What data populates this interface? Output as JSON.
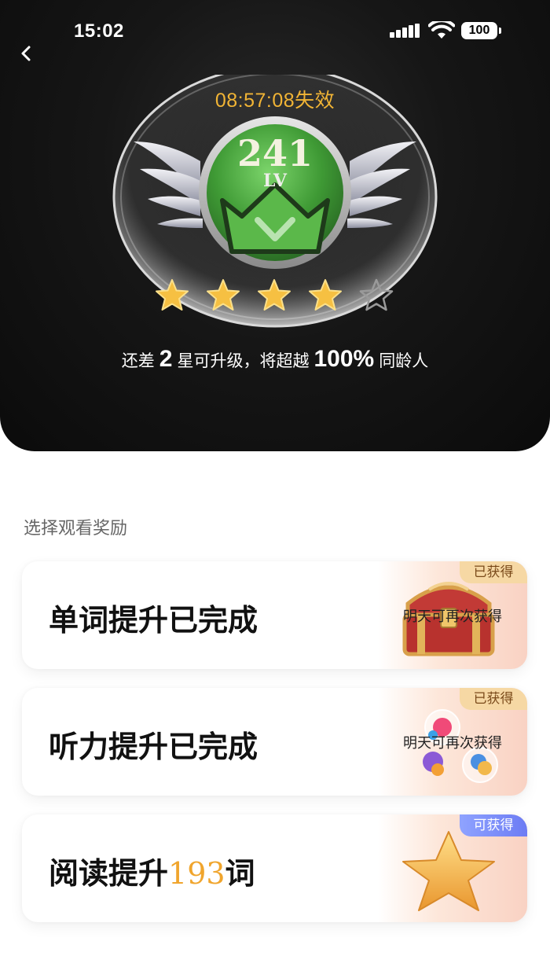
{
  "status_bar": {
    "time": "15:02",
    "battery": "100"
  },
  "hero": {
    "timer": "08:57:08失效",
    "level_number": "241",
    "level_unit": "LV",
    "stars_total": 5,
    "stars_filled": 4,
    "upgrade_prefix": "还差",
    "upgrade_stars_needed": "2",
    "upgrade_middle": "星可升级，将超越",
    "upgrade_percent": "100%",
    "upgrade_suffix": "同龄人"
  },
  "rewards": {
    "section_title": "选择观看奖励",
    "cards": [
      {
        "title": "单词提升已完成",
        "subtitle": "明天可再次获得",
        "tag": "已获得",
        "icon": "treasure-chest-icon"
      },
      {
        "title": "听力提升已完成",
        "subtitle": "明天可再次获得",
        "tag": "已获得",
        "icon": "candy-icon"
      },
      {
        "title_prefix": "阅读提升",
        "title_number": "193",
        "title_suffix": "词",
        "tag": "可获得",
        "icon": "gold-star-icon"
      }
    ]
  },
  "colors": {
    "accent_gold": "#f0a52d",
    "timer_orange": "#f1b435",
    "tag_obtained": "#f6d8a4",
    "tag_available": "#7b8bf7",
    "badge_green": "#4caf3d"
  }
}
